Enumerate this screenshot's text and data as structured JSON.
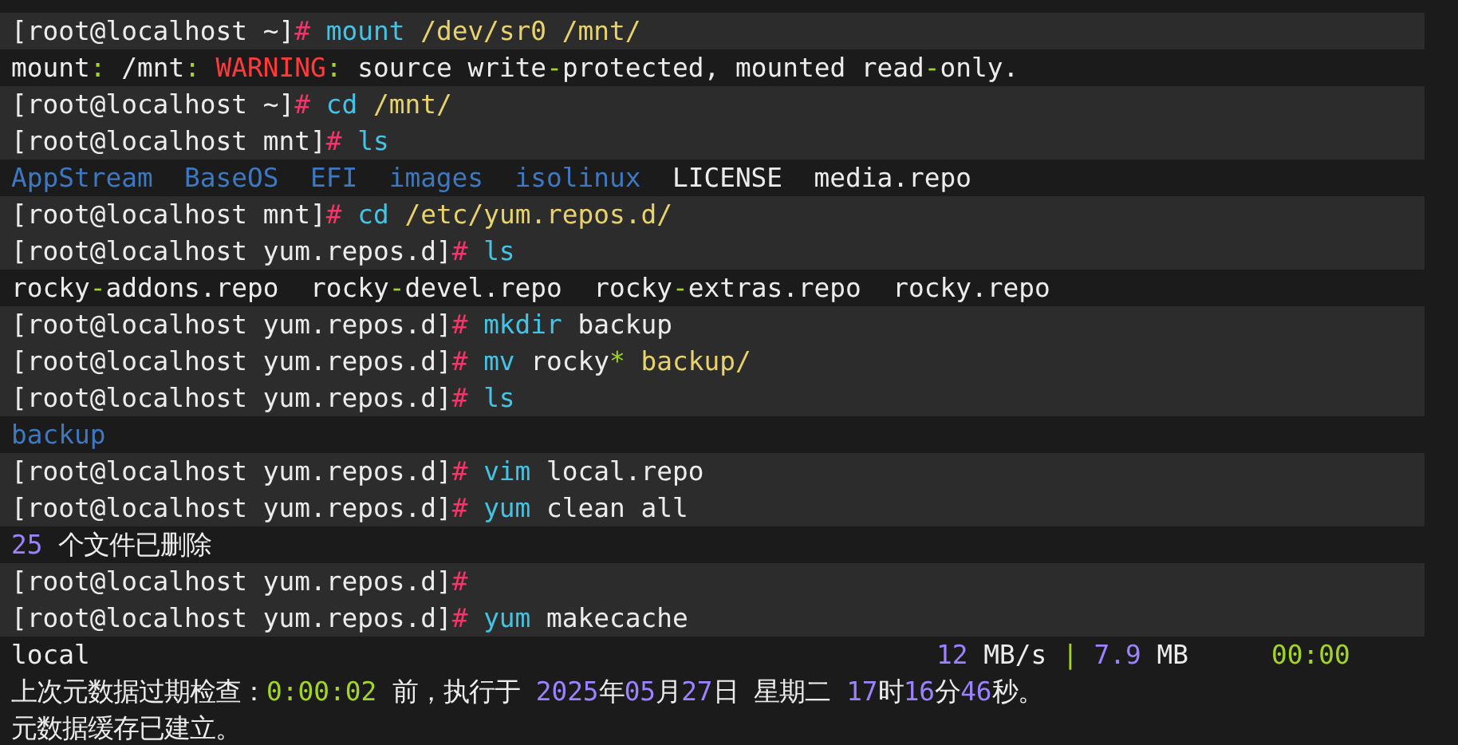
{
  "terminal": {
    "lines": [
      {
        "kind": "text",
        "shaded": true,
        "parts": [
          {
            "text": "[root@localhost ~]",
            "kind": "plain"
          },
          {
            "text": "# ",
            "kind": "hash"
          },
          {
            "text": "mount",
            "kind": "cmd"
          },
          {
            "text": " /dev/sr0 /mnt/",
            "kind": "arg"
          }
        ]
      },
      {
        "kind": "text",
        "shaded": false,
        "parts": [
          {
            "text": "mount",
            "kind": "plain"
          },
          {
            "text": ":",
            "kind": "green"
          },
          {
            "text": " /mnt",
            "kind": "plain"
          },
          {
            "text": ":",
            "kind": "green"
          },
          {
            "text": " WARNING",
            "kind": "warn"
          },
          {
            "text": ":",
            "kind": "green"
          },
          {
            "text": " source write",
            "kind": "plain"
          },
          {
            "text": "-",
            "kind": "green"
          },
          {
            "text": "protected, mounted read",
            "kind": "plain"
          },
          {
            "text": "-",
            "kind": "green"
          },
          {
            "text": "only.",
            "kind": "plain"
          }
        ]
      },
      {
        "kind": "text",
        "shaded": true,
        "parts": [
          {
            "text": "[root@localhost ~]",
            "kind": "plain"
          },
          {
            "text": "# ",
            "kind": "hash"
          },
          {
            "text": "cd",
            "kind": "cmd"
          },
          {
            "text": " /mnt/",
            "kind": "arg"
          }
        ]
      },
      {
        "kind": "text",
        "shaded": true,
        "parts": [
          {
            "text": "[root@localhost mnt]",
            "kind": "plain"
          },
          {
            "text": "# ",
            "kind": "hash"
          },
          {
            "text": "ls",
            "kind": "cmd"
          }
        ]
      },
      {
        "kind": "text",
        "shaded": false,
        "parts": [
          {
            "text": "AppStream  BaseOS  EFI  images  isolinux",
            "kind": "dir"
          },
          {
            "text": "  LICENSE  media.repo",
            "kind": "plain"
          }
        ]
      },
      {
        "kind": "text",
        "shaded": true,
        "parts": [
          {
            "text": "[root@localhost mnt]",
            "kind": "plain"
          },
          {
            "text": "# ",
            "kind": "hash"
          },
          {
            "text": "cd",
            "kind": "cmd"
          },
          {
            "text": " /etc/yum.repos.d/",
            "kind": "arg"
          }
        ]
      },
      {
        "kind": "text",
        "shaded": true,
        "parts": [
          {
            "text": "[root@localhost yum.repos.d]",
            "kind": "plain"
          },
          {
            "text": "# ",
            "kind": "hash"
          },
          {
            "text": "ls",
            "kind": "cmd"
          }
        ]
      },
      {
        "kind": "text",
        "shaded": false,
        "parts": [
          {
            "text": "rocky",
            "kind": "plain"
          },
          {
            "text": "-",
            "kind": "green"
          },
          {
            "text": "addons.repo  rocky",
            "kind": "plain"
          },
          {
            "text": "-",
            "kind": "green"
          },
          {
            "text": "devel.repo  rocky",
            "kind": "plain"
          },
          {
            "text": "-",
            "kind": "green"
          },
          {
            "text": "extras.repo  rocky.repo",
            "kind": "plain"
          }
        ]
      },
      {
        "kind": "text",
        "shaded": true,
        "parts": [
          {
            "text": "[root@localhost yum.repos.d]",
            "kind": "plain"
          },
          {
            "text": "# ",
            "kind": "hash"
          },
          {
            "text": "mkdir",
            "kind": "cmd"
          },
          {
            "text": " backup",
            "kind": "plain"
          }
        ]
      },
      {
        "kind": "text",
        "shaded": true,
        "parts": [
          {
            "text": "[root@localhost yum.repos.d]",
            "kind": "plain"
          },
          {
            "text": "# ",
            "kind": "hash"
          },
          {
            "text": "mv",
            "kind": "cmd"
          },
          {
            "text": " rocky",
            "kind": "plain"
          },
          {
            "text": "*",
            "kind": "green"
          },
          {
            "text": " backup/",
            "kind": "arg"
          }
        ]
      },
      {
        "kind": "text",
        "shaded": true,
        "parts": [
          {
            "text": "[root@localhost yum.repos.d]",
            "kind": "plain"
          },
          {
            "text": "# ",
            "kind": "hash"
          },
          {
            "text": "ls",
            "kind": "cmd"
          }
        ]
      },
      {
        "kind": "text",
        "shaded": false,
        "parts": [
          {
            "text": "backup",
            "kind": "dir"
          }
        ]
      },
      {
        "kind": "text",
        "shaded": true,
        "parts": [
          {
            "text": "[root@localhost yum.repos.d]",
            "kind": "plain"
          },
          {
            "text": "# ",
            "kind": "hash"
          },
          {
            "text": "vim",
            "kind": "cmd"
          },
          {
            "text": " local.repo",
            "kind": "plain"
          }
        ]
      },
      {
        "kind": "text",
        "shaded": true,
        "parts": [
          {
            "text": "[root@localhost yum.repos.d]",
            "kind": "plain"
          },
          {
            "text": "# ",
            "kind": "hash"
          },
          {
            "text": "yum",
            "kind": "cmd"
          },
          {
            "text": " clean all",
            "kind": "plain"
          }
        ]
      },
      {
        "kind": "text",
        "shaded": false,
        "parts": [
          {
            "text": "25",
            "kind": "num"
          },
          {
            "text": " 个文件已删除",
            "kind": "plain"
          }
        ]
      },
      {
        "kind": "text",
        "shaded": true,
        "parts": [
          {
            "text": "[root@localhost yum.repos.d]",
            "kind": "plain"
          },
          {
            "text": "#",
            "kind": "hash"
          }
        ]
      },
      {
        "kind": "text",
        "shaded": true,
        "parts": [
          {
            "text": "[root@localhost yum.repos.d]",
            "kind": "plain"
          },
          {
            "text": "# ",
            "kind": "hash"
          },
          {
            "text": "yum",
            "kind": "cmd"
          },
          {
            "text": " makecache",
            "kind": "plain"
          }
        ]
      },
      {
        "kind": "progress",
        "shaded": false,
        "name": "local",
        "parts": [
          {
            "text": "12",
            "kind": "num"
          },
          {
            "text": " MB/s ",
            "kind": "plain"
          },
          {
            "text": "|",
            "kind": "green"
          },
          {
            "text": " 7.9",
            "kind": "num"
          },
          {
            "text": " MB",
            "kind": "plain"
          }
        ],
        "time": "00:00"
      },
      {
        "kind": "text",
        "shaded": false,
        "parts": [
          {
            "text": "上次元数据过期检查：",
            "kind": "plain"
          },
          {
            "text": "0:00:02",
            "kind": "green"
          },
          {
            "text": " 前，执行于 ",
            "kind": "plain"
          },
          {
            "text": "2025",
            "kind": "num"
          },
          {
            "text": "年",
            "kind": "plain"
          },
          {
            "text": "05",
            "kind": "num"
          },
          {
            "text": "月",
            "kind": "plain"
          },
          {
            "text": "27",
            "kind": "num"
          },
          {
            "text": "日 星期二 ",
            "kind": "plain"
          },
          {
            "text": "17",
            "kind": "num"
          },
          {
            "text": "时",
            "kind": "plain"
          },
          {
            "text": "16",
            "kind": "num"
          },
          {
            "text": "分",
            "kind": "plain"
          },
          {
            "text": "46",
            "kind": "num"
          },
          {
            "text": "秒。",
            "kind": "plain"
          }
        ]
      },
      {
        "kind": "text",
        "shaded": false,
        "parts": [
          {
            "text": "元数据缓存已建立。",
            "kind": "plain"
          }
        ]
      }
    ]
  }
}
